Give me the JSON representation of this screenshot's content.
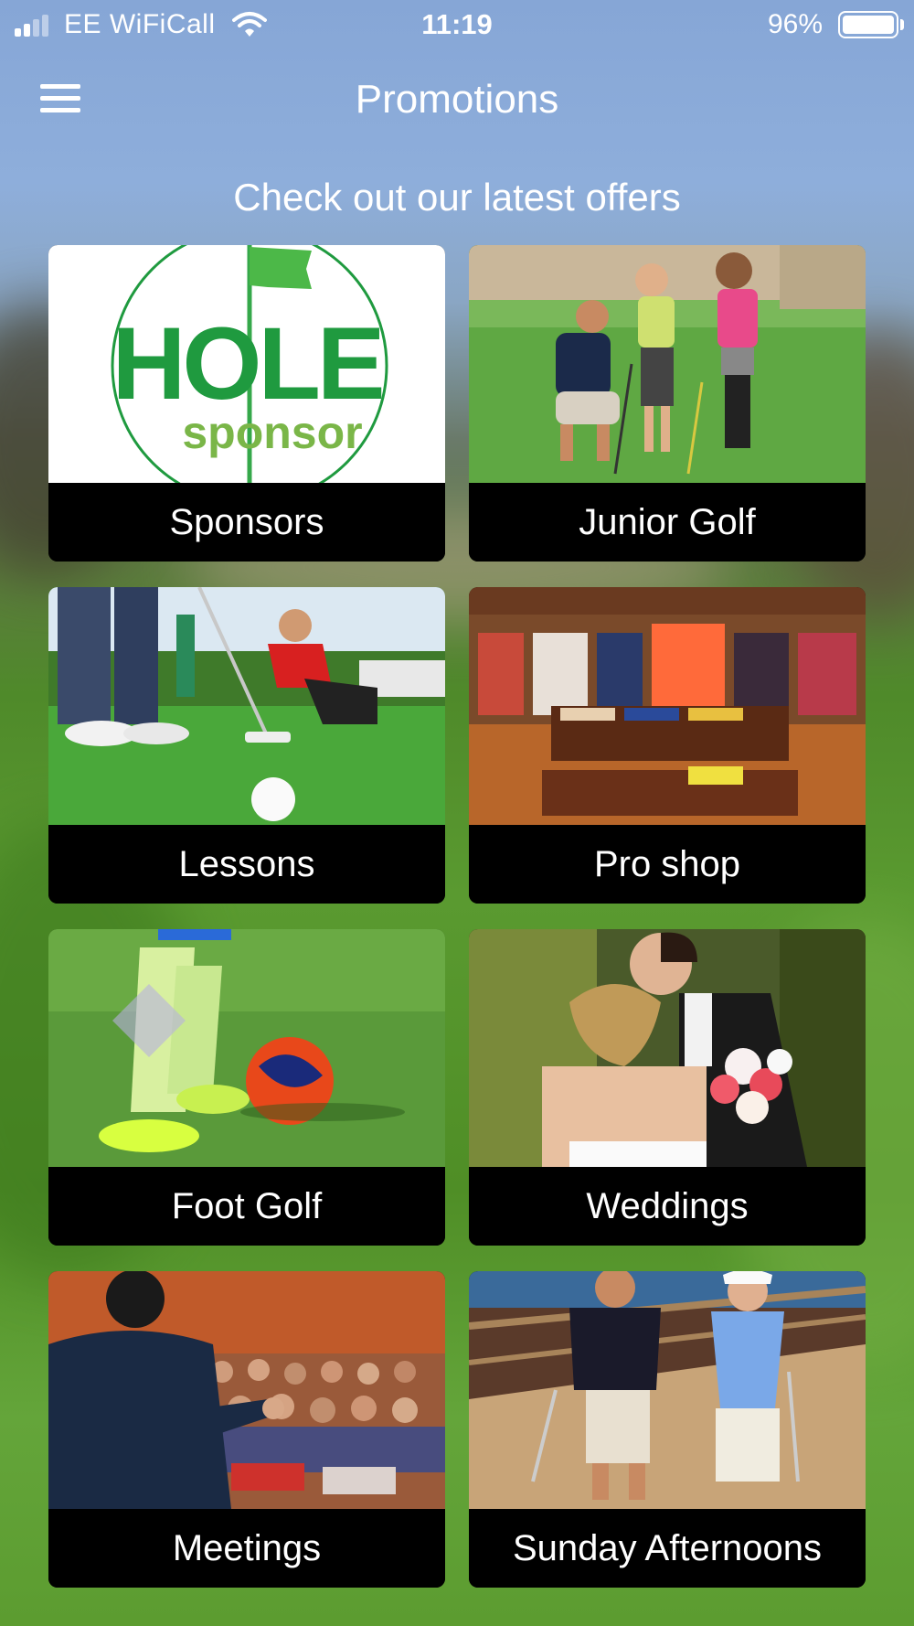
{
  "status_bar": {
    "carrier": "EE WiFiCall",
    "time": "11:19",
    "battery": "96%"
  },
  "header": {
    "title": "Promotions",
    "menu_icon": "hamburger-menu-icon"
  },
  "subtitle": "Check out our latest offers",
  "cards": [
    {
      "label": "Sponsors",
      "logo_text_1": "HOLE",
      "logo_text_2": "sponsor"
    },
    {
      "label": "Junior Golf"
    },
    {
      "label": "Lessons"
    },
    {
      "label": "Pro shop"
    },
    {
      "label": "Foot Golf"
    },
    {
      "label": "Weddings"
    },
    {
      "label": "Meetings"
    },
    {
      "label": "Sunday Afternoons"
    }
  ],
  "colors": {
    "brand_green": "#1f9a3f",
    "label_bg": "#000000",
    "text": "#ffffff"
  }
}
